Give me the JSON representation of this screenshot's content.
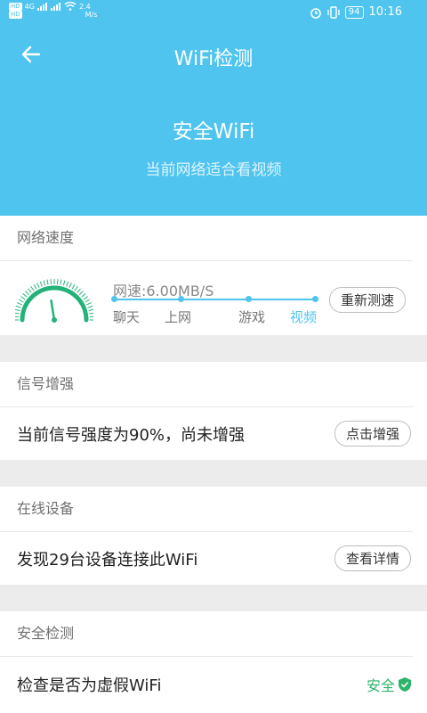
{
  "status_bar": {
    "sim1": "HD",
    "sim2": "HD",
    "net_type": "4G",
    "net_speed_value": "2.4",
    "net_speed_unit": "M/s",
    "battery": "94",
    "time": "10:16"
  },
  "header": {
    "title": "WiFi检测",
    "status": "安全WiFi",
    "subtitle": "当前网络适合看视频"
  },
  "sections": {
    "speed": {
      "title": "网络速度",
      "speed_text": "网速:6.00MB/S",
      "levels": [
        "聊天",
        "上网",
        "游戏",
        "视频"
      ],
      "active_level": "视频",
      "gauge_level_percent": 45,
      "button": "重新测速"
    },
    "signal": {
      "title": "信号增强",
      "text": "当前信号强度为90%，尚未增强",
      "button": "点击增强"
    },
    "devices": {
      "title": "在线设备",
      "text": "发现29台设备连接此WiFi",
      "button": "查看详情"
    },
    "security": {
      "title": "安全检测",
      "text": "检查是否为虚假WiFi",
      "result": "安全"
    }
  },
  "colors": {
    "header_bg": "#4ec4ef",
    "accent": "#4ec4ef",
    "gauge": "#23b378",
    "safe": "#2db46a"
  }
}
